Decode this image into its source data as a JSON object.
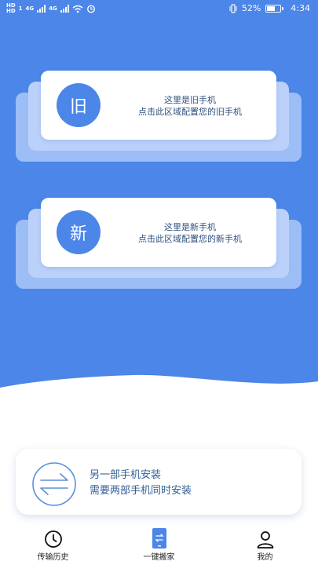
{
  "status_bar": {
    "left_tag_top": "HD",
    "left_tag_bottom": "1",
    "net_1": "4G",
    "net_2": "4G",
    "battery_percent": "52%",
    "time": "4:34"
  },
  "old_phone": {
    "badge": "旧",
    "line1": "这里是旧手机",
    "line2": "点击此区域配置您的旧手机"
  },
  "new_phone": {
    "badge": "新",
    "line1": "这里是新手机",
    "line2": "点击此区域配置您的新手机"
  },
  "install_card": {
    "line1": "另一部手机安装",
    "line2": "需要两部手机同时安装"
  },
  "tabs": [
    {
      "label": "传输历史",
      "icon": "clock-icon"
    },
    {
      "label": "一键搬家",
      "icon": "phone-transfer-icon"
    },
    {
      "label": "我的",
      "icon": "person-icon"
    }
  ],
  "colors": {
    "primary_blue": "#4b86e8",
    "layer_blue_light": "#bcd1fa",
    "layer_blue_mid": "#9dbdf7",
    "text_blue": "#2f5f95"
  }
}
